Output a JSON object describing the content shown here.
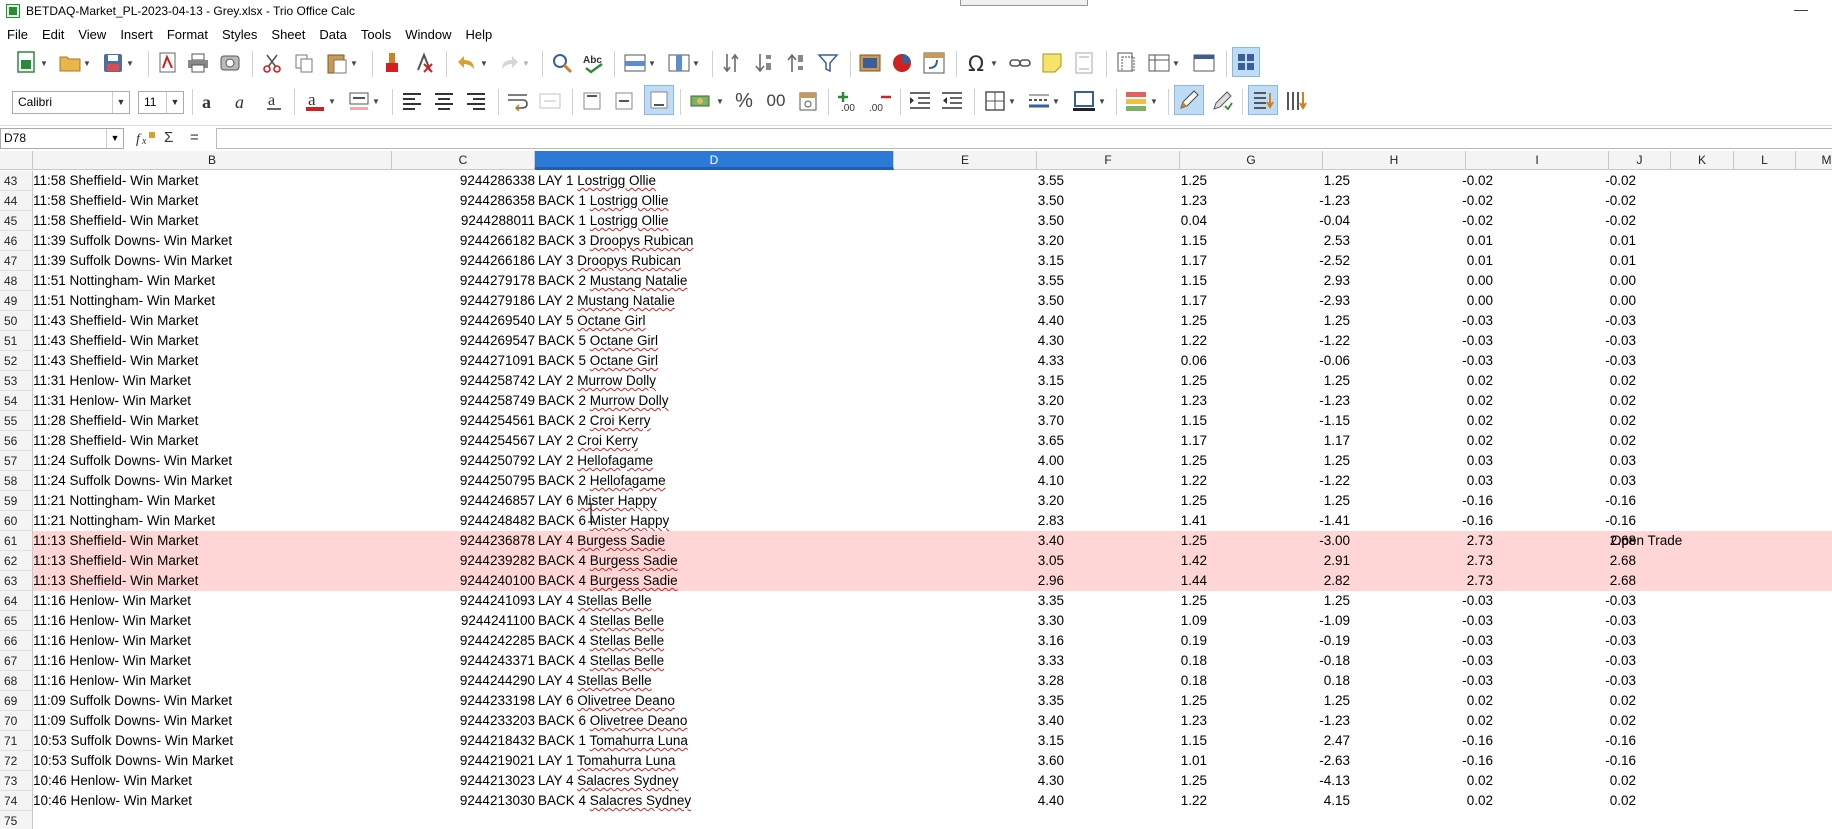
{
  "window": {
    "title": "BETDAQ-Market_PL-2023-04-13 - Grey.xlsx - Trio Office Calc",
    "minimize_glyph": "—"
  },
  "menu": [
    "File",
    "Edit",
    "View",
    "Insert",
    "Format",
    "Styles",
    "Sheet",
    "Data",
    "Tools",
    "Window",
    "Help"
  ],
  "toolbar2": {
    "font_name": "Calibri",
    "font_size": "11",
    "percent_glyph": "%",
    "decimal_glyph": "00"
  },
  "formula_bar": {
    "cell_ref": "D78",
    "content": ""
  },
  "columns": [
    "B",
    "C",
    "D",
    "E",
    "F",
    "G",
    "H",
    "I",
    "J",
    "K",
    "L",
    "M"
  ],
  "active_column": "D",
  "rows": [
    {
      "n": "43",
      "b": "11:58 Sheffield- Win Market",
      "c": "9244286338",
      "d": "LAY 1 Lostrigg Ollie",
      "e": "3.55",
      "f": "1.25",
      "g": "1.25",
      "h": "-0.02",
      "i": "-0.02",
      "j": "",
      "hl": false
    },
    {
      "n": "44",
      "b": "11:58 Sheffield- Win Market",
      "c": "9244286358",
      "d": "BACK 1 Lostrigg Ollie",
      "e": "3.50",
      "f": "1.23",
      "g": "-1.23",
      "h": "-0.02",
      "i": "-0.02",
      "j": "",
      "hl": false
    },
    {
      "n": "45",
      "b": "11:58 Sheffield- Win Market",
      "c": "9244288011",
      "d": "BACK 1 Lostrigg Ollie",
      "e": "3.50",
      "f": "0.04",
      "g": "-0.04",
      "h": "-0.02",
      "i": "-0.02",
      "j": "",
      "hl": false
    },
    {
      "n": "46",
      "b": "11:39 Suffolk Downs- Win Market",
      "c": "9244266182",
      "d": "BACK 3 Droopys Rubican",
      "e": "3.20",
      "f": "1.15",
      "g": "2.53",
      "h": "0.01",
      "i": "0.01",
      "j": "",
      "hl": false
    },
    {
      "n": "47",
      "b": "11:39 Suffolk Downs- Win Market",
      "c": "9244266186",
      "d": "LAY 3 Droopys Rubican",
      "e": "3.15",
      "f": "1.17",
      "g": "-2.52",
      "h": "0.01",
      "i": "0.01",
      "j": "",
      "hl": false
    },
    {
      "n": "48",
      "b": "11:51 Nottingham- Win Market",
      "c": "9244279178",
      "d": "BACK 2 Mustang Natalie",
      "e": "3.55",
      "f": "1.15",
      "g": "2.93",
      "h": "0.00",
      "i": "0.00",
      "j": "",
      "hl": false
    },
    {
      "n": "49",
      "b": "11:51 Nottingham- Win Market",
      "c": "9244279186",
      "d": "LAY 2 Mustang Natalie",
      "e": "3.50",
      "f": "1.17",
      "g": "-2.93",
      "h": "0.00",
      "i": "0.00",
      "j": "",
      "hl": false
    },
    {
      "n": "50",
      "b": "11:43 Sheffield- Win Market",
      "c": "9244269540",
      "d": "LAY 5 Octane Girl",
      "e": "4.40",
      "f": "1.25",
      "g": "1.25",
      "h": "-0.03",
      "i": "-0.03",
      "j": "",
      "hl": false
    },
    {
      "n": "51",
      "b": "11:43 Sheffield- Win Market",
      "c": "9244269547",
      "d": "BACK 5 Octane Girl",
      "e": "4.30",
      "f": "1.22",
      "g": "-1.22",
      "h": "-0.03",
      "i": "-0.03",
      "j": "",
      "hl": false
    },
    {
      "n": "52",
      "b": "11:43 Sheffield- Win Market",
      "c": "9244271091",
      "d": "BACK 5 Octane Girl",
      "e": "4.33",
      "f": "0.06",
      "g": "-0.06",
      "h": "-0.03",
      "i": "-0.03",
      "j": "",
      "hl": false
    },
    {
      "n": "53",
      "b": "11:31 Henlow- Win Market",
      "c": "9244258742",
      "d": "LAY 2 Murrow Dolly",
      "e": "3.15",
      "f": "1.25",
      "g": "1.25",
      "h": "0.02",
      "i": "0.02",
      "j": "",
      "hl": false
    },
    {
      "n": "54",
      "b": "11:31 Henlow- Win Market",
      "c": "9244258749",
      "d": "BACK 2 Murrow Dolly",
      "e": "3.20",
      "f": "1.23",
      "g": "-1.23",
      "h": "0.02",
      "i": "0.02",
      "j": "",
      "hl": false
    },
    {
      "n": "55",
      "b": "11:28 Sheffield- Win Market",
      "c": "9244254561",
      "d": "BACK 2 Croi Kerry",
      "e": "3.70",
      "f": "1.15",
      "g": "-1.15",
      "h": "0.02",
      "i": "0.02",
      "j": "",
      "hl": false
    },
    {
      "n": "56",
      "b": "11:28 Sheffield- Win Market",
      "c": "9244254567",
      "d": "LAY 2 Croi Kerry",
      "e": "3.65",
      "f": "1.17",
      "g": "1.17",
      "h": "0.02",
      "i": "0.02",
      "j": "",
      "hl": false
    },
    {
      "n": "57",
      "b": "11:24 Suffolk Downs- Win Market",
      "c": "9244250792",
      "d": "LAY 2 Hellofagame",
      "e": "4.00",
      "f": "1.25",
      "g": "1.25",
      "h": "0.03",
      "i": "0.03",
      "j": "",
      "hl": false
    },
    {
      "n": "58",
      "b": "11:24 Suffolk Downs- Win Market",
      "c": "9244250795",
      "d": "BACK 2 Hellofagame",
      "e": "4.10",
      "f": "1.22",
      "g": "-1.22",
      "h": "0.03",
      "i": "0.03",
      "j": "",
      "hl": false
    },
    {
      "n": "59",
      "b": "11:21 Nottingham- Win Market",
      "c": "9244246857",
      "d": "LAY 6 Mister Happy",
      "e": "3.20",
      "f": "1.25",
      "g": "1.25",
      "h": "-0.16",
      "i": "-0.16",
      "j": "",
      "hl": false
    },
    {
      "n": "60",
      "b": "11:21 Nottingham- Win Market",
      "c": "9244248482",
      "d": "BACK 6 Mister Happy",
      "e": "2.83",
      "f": "1.41",
      "g": "-1.41",
      "h": "-0.16",
      "i": "-0.16",
      "j": "",
      "hl": false
    },
    {
      "n": "61",
      "b": "11:13 Sheffield- Win Market",
      "c": "9244236878",
      "d": "LAY 4 Burgess Sadie",
      "e": "3.40",
      "f": "1.25",
      "g": "-3.00",
      "h": "2.73",
      "i": "2.68",
      "j": "Open Trade",
      "hl": true
    },
    {
      "n": "62",
      "b": "11:13 Sheffield- Win Market",
      "c": "9244239282",
      "d": "BACK 4 Burgess Sadie",
      "e": "3.05",
      "f": "1.42",
      "g": "2.91",
      "h": "2.73",
      "i": "2.68",
      "j": "",
      "hl": true
    },
    {
      "n": "63",
      "b": "11:13 Sheffield- Win Market",
      "c": "9244240100",
      "d": "BACK 4 Burgess Sadie",
      "e": "2.96",
      "f": "1.44",
      "g": "2.82",
      "h": "2.73",
      "i": "2.68",
      "j": "",
      "hl": true
    },
    {
      "n": "64",
      "b": "11:16 Henlow- Win Market",
      "c": "9244241093",
      "d": "LAY 4 Stellas Belle",
      "e": "3.35",
      "f": "1.25",
      "g": "1.25",
      "h": "-0.03",
      "i": "-0.03",
      "j": "",
      "hl": false
    },
    {
      "n": "65",
      "b": "11:16 Henlow- Win Market",
      "c": "9244241100",
      "d": "BACK 4 Stellas Belle",
      "e": "3.30",
      "f": "1.09",
      "g": "-1.09",
      "h": "-0.03",
      "i": "-0.03",
      "j": "",
      "hl": false
    },
    {
      "n": "66",
      "b": "11:16 Henlow- Win Market",
      "c": "9244242285",
      "d": "BACK 4 Stellas Belle",
      "e": "3.16",
      "f": "0.19",
      "g": "-0.19",
      "h": "-0.03",
      "i": "-0.03",
      "j": "",
      "hl": false
    },
    {
      "n": "67",
      "b": "11:16 Henlow- Win Market",
      "c": "9244243371",
      "d": "BACK 4 Stellas Belle",
      "e": "3.33",
      "f": "0.18",
      "g": "-0.18",
      "h": "-0.03",
      "i": "-0.03",
      "j": "",
      "hl": false
    },
    {
      "n": "68",
      "b": "11:16 Henlow- Win Market",
      "c": "9244244290",
      "d": "LAY 4 Stellas Belle",
      "e": "3.28",
      "f": "0.18",
      "g": "0.18",
      "h": "-0.03",
      "i": "-0.03",
      "j": "",
      "hl": false
    },
    {
      "n": "69",
      "b": "11:09 Suffolk Downs- Win Market",
      "c": "9244233198",
      "d": "LAY 6 Olivetree Deano",
      "e": "3.35",
      "f": "1.25",
      "g": "1.25",
      "h": "0.02",
      "i": "0.02",
      "j": "",
      "hl": false
    },
    {
      "n": "70",
      "b": "11:09 Suffolk Downs- Win Market",
      "c": "9244233203",
      "d": "BACK 6 Olivetree Deano",
      "e": "3.40",
      "f": "1.23",
      "g": "-1.23",
      "h": "0.02",
      "i": "0.02",
      "j": "",
      "hl": false
    },
    {
      "n": "71",
      "b": "10:53 Suffolk Downs- Win Market",
      "c": "9244218432",
      "d": "BACK 1 Tomahurra Luna",
      "e": "3.15",
      "f": "1.15",
      "g": "2.47",
      "h": "-0.16",
      "i": "-0.16",
      "j": "",
      "hl": false
    },
    {
      "n": "72",
      "b": "10:53 Suffolk Downs- Win Market",
      "c": "9244219021",
      "d": "LAY 1 Tomahurra Luna",
      "e": "3.60",
      "f": "1.01",
      "g": "-2.63",
      "h": "-0.16",
      "i": "-0.16",
      "j": "",
      "hl": false
    },
    {
      "n": "73",
      "b": "10:46 Henlow- Win Market",
      "c": "9244213023",
      "d": "LAY 4 Salacres Sydney",
      "e": "4.30",
      "f": "1.25",
      "g": "-4.13",
      "h": "0.02",
      "i": "0.02",
      "j": "",
      "hl": false
    },
    {
      "n": "74",
      "b": "10:46 Henlow- Win Market",
      "c": "9244213030",
      "d": "BACK 4 Salacres Sydney",
      "e": "4.40",
      "f": "1.22",
      "g": "4.15",
      "h": "0.02",
      "i": "0.02",
      "j": "",
      "hl": false
    },
    {
      "n": "75",
      "b": "",
      "c": "",
      "d": "",
      "e": "",
      "f": "",
      "g": "",
      "h": "",
      "i": "",
      "j": "",
      "hl": false
    }
  ],
  "colors": {
    "highlight_row": "#ffd6d6",
    "active_column_header": "#2c7ad6",
    "spell_error": "#d02020"
  }
}
